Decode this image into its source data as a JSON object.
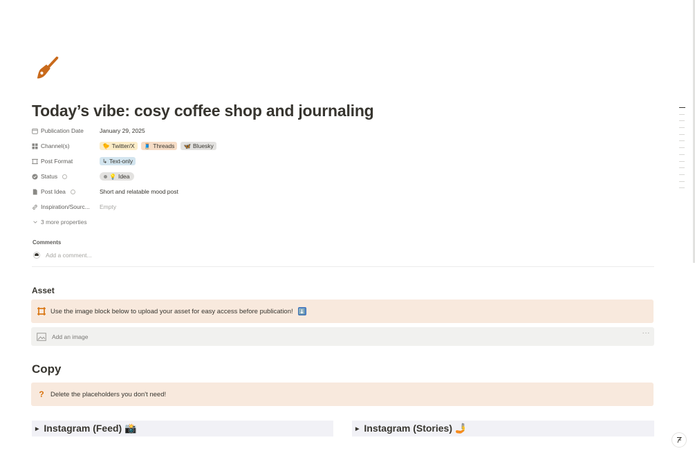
{
  "page": {
    "icon": "paintbrush-icon",
    "title": "Today’s vibe: cosy coffee shop and journaling"
  },
  "properties": [
    {
      "key": "Publication Date",
      "icon": "calendar-icon",
      "value": "January 29, 2025"
    },
    {
      "key": "Channel(s)",
      "icon": "grid-icon"
    },
    {
      "key": "Post Format",
      "icon": "frame-icon"
    },
    {
      "key": "Status",
      "icon": "status-icon"
    },
    {
      "key": "Post Idea",
      "icon": "document-icon",
      "value": "Short and relatable mood post"
    },
    {
      "key": "Inspiration/Sourc...",
      "icon": "link-icon",
      "value": "Empty"
    }
  ],
  "channels": [
    {
      "label": "Twitter/X",
      "emoji": "🐤",
      "color": "#fbecc7"
    },
    {
      "label": "Threads",
      "emoji": "🧵",
      "color": "#f6dcc6"
    },
    {
      "label": "Bluesky",
      "emoji": "🦋",
      "color": "#e3e2e0"
    }
  ],
  "post_format": {
    "label": "Text-only",
    "emoji": "↳",
    "color": "#d3e5ef"
  },
  "status": {
    "label": "Idea",
    "emoji": "💡"
  },
  "more_properties": "3 more properties",
  "comments": {
    "label": "Comments",
    "placeholder": "Add a comment..."
  },
  "asset": {
    "heading": "Asset",
    "callout": "Use the image block below to upload your asset for easy access before publication!",
    "callout_emoji": "⬇️",
    "image_placeholder": "Add an image",
    "menu": "···"
  },
  "copy": {
    "heading": "Copy",
    "callout_icon": "?",
    "callout": "Delete the placeholders you don't need!",
    "toggles": [
      {
        "label": "Instagram (Feed) 📸"
      },
      {
        "label": "Instagram (Stories) 🤳"
      }
    ]
  },
  "colors": {
    "accent": "#d9730d",
    "callout_bg": "#f8e9dd"
  }
}
